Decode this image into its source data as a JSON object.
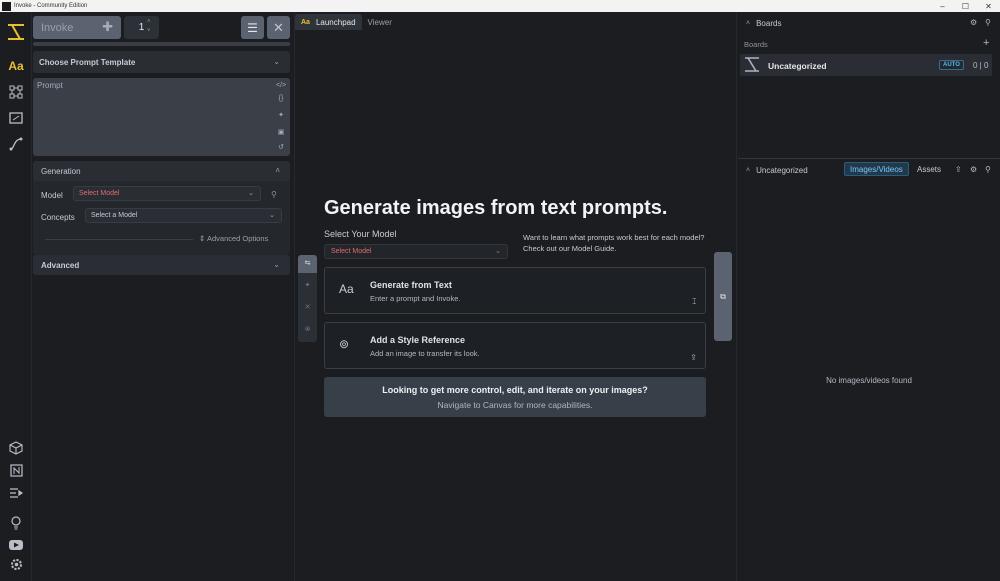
{
  "window": {
    "title": "Invoke - Community Edition",
    "controls": [
      "–",
      "☐",
      "✕"
    ]
  },
  "left_panel": {
    "invoke_label": "Invoke",
    "iterations": "1",
    "prompt_template": "Choose Prompt Template",
    "prompt_label": "Prompt",
    "generation_title": "Generation",
    "model_label": "Model",
    "model_value": "Select Model",
    "concepts_label": "Concepts",
    "concepts_value": "Select a Model",
    "advanced_options": "Advanced Options",
    "advanced_title": "Advanced"
  },
  "center": {
    "tabs": [
      {
        "label": "Launchpad",
        "active": true
      },
      {
        "label": "Viewer",
        "active": false
      }
    ],
    "tab_badge": "Aa",
    "heading": "Generate images from text prompts.",
    "select_model_label": "Select Your Model",
    "select_model_value": "Select Model",
    "help_text": "Want to learn what prompts work best for each model? Check out our Model Guide.",
    "options": [
      {
        "title": "Generate from Text",
        "desc": "Enter a prompt and Invoke.",
        "icon": "Aa"
      },
      {
        "title": "Add a Style Reference",
        "desc": "Add an image to transfer its look.",
        "icon": "⊚"
      }
    ],
    "canvas_title": "Looking to get more control, edit, and iterate on your images?",
    "canvas_sub": "Navigate to Canvas for more capabilities."
  },
  "right_panel": {
    "boards_header": "Boards",
    "boards_label": "Boards",
    "board": {
      "name": "Uncategorized",
      "auto_label": "AUTO",
      "counts": "0 | 0"
    },
    "gallery_header": "Uncategorized",
    "gallery_tabs": [
      {
        "label": "Images/Videos",
        "active": true
      },
      {
        "label": "Assets",
        "active": false
      }
    ],
    "empty_text": "No images/videos found"
  },
  "colors": {
    "accent": "#e8c02e",
    "link_blue": "#7fc3ee",
    "warning_red": "#e26b6b"
  }
}
